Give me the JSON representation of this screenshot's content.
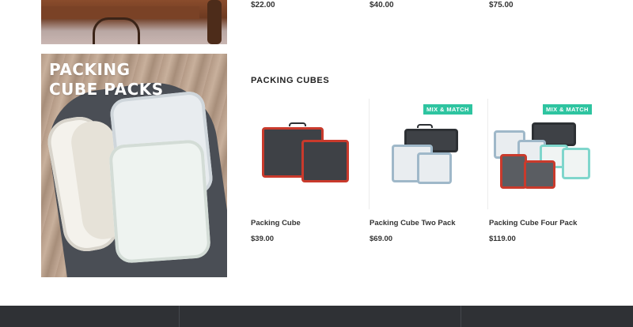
{
  "top_row": {
    "prices": [
      "$22.00",
      "$40.00",
      "$75.00"
    ]
  },
  "feature": {
    "title": "PACKING CUBE PACKS"
  },
  "section": {
    "title": "PACKING CUBES"
  },
  "products": [
    {
      "name": "Packing Cube",
      "price": "$39.00",
      "badge": ""
    },
    {
      "name": "Packing Cube Two Pack",
      "price": "$69.00",
      "badge": "MIX & MATCH"
    },
    {
      "name": "Packing Cube Four Pack",
      "price": "$119.00",
      "badge": "MIX & MATCH"
    }
  ],
  "colors": {
    "badge": "#2ec4a0",
    "footer": "#2f3135",
    "accent_red": "#c93a2c"
  }
}
